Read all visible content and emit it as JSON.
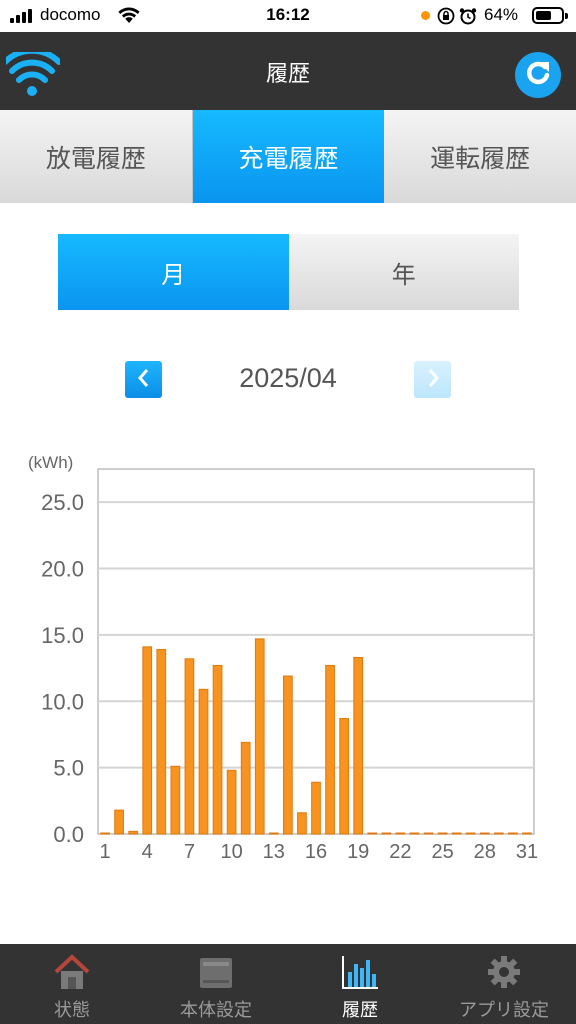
{
  "status_bar": {
    "carrier": "docomo",
    "time": "16:12",
    "battery_percent": "64%",
    "battery_level": 0.64,
    "icons": [
      "signal-icon",
      "wifi-icon",
      "orange-dot-indicator",
      "orientation-lock-icon",
      "alarm-icon",
      "battery-icon"
    ]
  },
  "header": {
    "title": "履歴",
    "left_icon": "wifi-logo-icon",
    "right_icon": "refresh-icon"
  },
  "tabs": [
    {
      "label": "放電履歴",
      "active": false
    },
    {
      "label": "充電履歴",
      "active": true
    },
    {
      "label": "運転履歴",
      "active": false
    }
  ],
  "period_toggle": [
    {
      "label": "月",
      "active": true
    },
    {
      "label": "年",
      "active": false
    }
  ],
  "pager": {
    "current": "2025/04",
    "prev_icon": "chevron-left-icon",
    "next_icon": "chevron-right-icon"
  },
  "colors": {
    "accent": "#0a95f0",
    "header_bg": "#333333",
    "bar": "#f7931e",
    "bar_edge": "#e07a10"
  },
  "chart_data": {
    "type": "bar",
    "ylabel": "(kWh)",
    "ylim": [
      0,
      27.5
    ],
    "yticks": [
      "0.0",
      "5.0",
      "10.0",
      "15.0",
      "20.0",
      "25.0"
    ],
    "ytick_values": [
      0,
      5,
      10,
      15,
      20,
      25
    ],
    "xticks": [
      "1",
      "4",
      "7",
      "10",
      "13",
      "16",
      "19",
      "22",
      "25",
      "28",
      "31"
    ],
    "xtick_values": [
      1,
      4,
      7,
      10,
      13,
      16,
      19,
      22,
      25,
      28,
      31
    ],
    "categories": [
      1,
      2,
      3,
      4,
      5,
      6,
      7,
      8,
      9,
      10,
      11,
      12,
      13,
      14,
      15,
      16,
      17,
      18,
      19,
      20,
      21,
      22,
      23,
      24,
      25,
      26,
      27,
      28,
      29,
      30,
      31
    ],
    "values": [
      0.0,
      1.8,
      0.2,
      14.1,
      13.9,
      5.1,
      13.2,
      10.9,
      12.7,
      4.8,
      6.9,
      14.7,
      0.0,
      11.9,
      1.6,
      3.9,
      12.7,
      8.7,
      13.3,
      0.0,
      0.0,
      0.0,
      0.0,
      0.0,
      0.0,
      0.0,
      0.0,
      0.0,
      0.0,
      0.0,
      0.0
    ],
    "grid": true
  },
  "bottom_nav": [
    {
      "label": "状態",
      "icon": "house-icon",
      "active": false
    },
    {
      "label": "本体設定",
      "icon": "battery-unit-icon",
      "active": false
    },
    {
      "label": "履歴",
      "icon": "bar-chart-icon",
      "active": true
    },
    {
      "label": "アプリ設定",
      "icon": "gear-icon",
      "active": false
    }
  ]
}
